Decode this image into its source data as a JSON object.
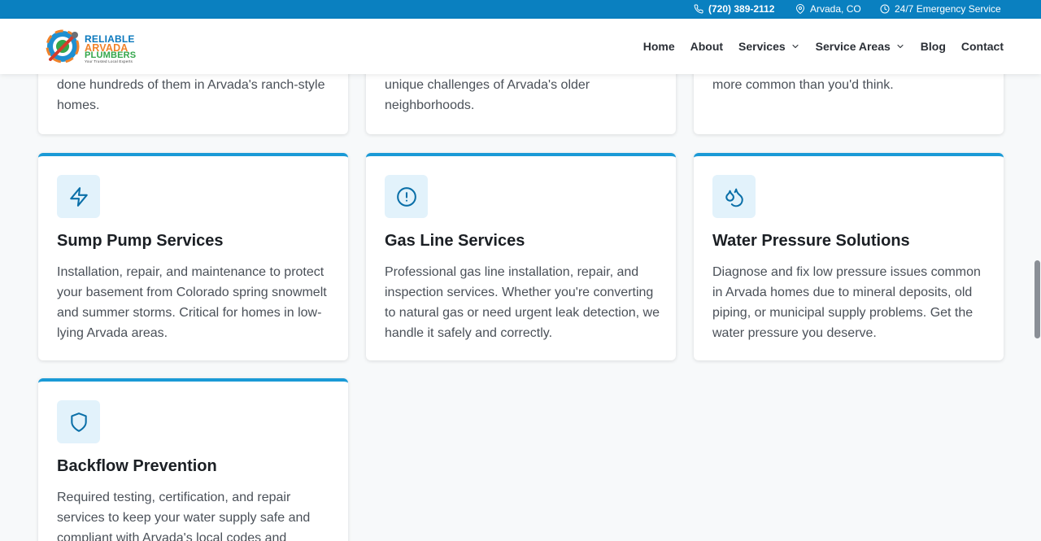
{
  "topbar": {
    "phone": "(720) 389-2112",
    "location": "Arvada, CO",
    "emergency": "24/7 Emergency Service"
  },
  "logo": {
    "line1": "RELIABLE",
    "line2": "ARVADA",
    "line3": "PLUMBERS",
    "tagline": "Your Trusted Local Experts"
  },
  "nav": {
    "home": "Home",
    "about": "About",
    "services": "Services",
    "service_areas": "Service Areas",
    "blog": "Blog",
    "contact": "Contact"
  },
  "partial_cards": [
    {
      "text": "done hundreds of them in Arvada's ranch-style homes."
    },
    {
      "text": "unique challenges of Arvada's older neighborhoods."
    },
    {
      "text": "more common than you'd think."
    }
  ],
  "services": [
    {
      "icon": "lightning-icon",
      "title": "Sump Pump Services",
      "description": "Installation, repair, and maintenance to protect your basement from Colorado spring snowmelt and summer storms. Critical for homes in low-lying Arvada areas."
    },
    {
      "icon": "alert-circle-icon",
      "title": "Gas Line Services",
      "description": "Professional gas line installation, repair, and inspection services. Whether you're converting to natural gas or need urgent leak detection, we handle it safely and correctly."
    },
    {
      "icon": "droplets-icon",
      "title": "Water Pressure Solutions",
      "description": "Diagnose and fix low pressure issues common in Arvada homes due to mineral deposits, old piping, or municipal supply problems. Get the water pressure you deserve."
    },
    {
      "icon": "shield-icon",
      "title": "Backflow Prevention",
      "description": "Required testing, certification, and repair services to keep your water supply safe and compliant with Arvada's local codes and"
    }
  ],
  "colors": {
    "topbar": "#0a80c0",
    "accent": "#1a9ad6",
    "icon_bg": "#e2f2fb",
    "icon_stroke": "#0a6fa8"
  }
}
